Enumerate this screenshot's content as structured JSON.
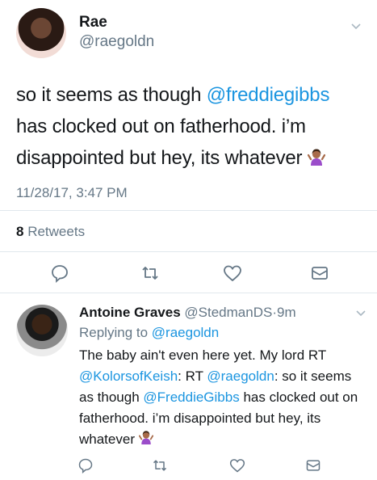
{
  "main": {
    "name": "Rae",
    "handle": "@raegoldn",
    "text_before": "so it seems as though ",
    "mention": "@freddiegibbs",
    "text_after": " has clocked out on fatherhood.  i’m disappointed but hey, its whatever",
    "emoji_icon": "woman-shrugging-emoji",
    "timestamp": "11/28/17, 3:47 PM",
    "retweet_count": "8",
    "retweet_label": "Retweets"
  },
  "reply": {
    "name": "Antoine Graves",
    "handle": "@StedmanDS",
    "separator": "·",
    "age": "9m",
    "replying_label": "Replying to",
    "replying_to": "@raegoldn",
    "t1": "The baby ain't even here yet.  My lord RT ",
    "m1": "@KolorsofKeish",
    "t2": ": RT ",
    "m2": "@raegoldn",
    "t3": ": so it seems as though ",
    "m3": "@FreddieGibbs",
    "t4": " has clocked out on fatherhood.  i’m disappointed but hey, its whatever"
  },
  "icons": {
    "reply": "reply-icon",
    "retweet": "retweet-icon",
    "like": "heart-icon",
    "dm": "envelope-icon",
    "more": "chevron-down-icon"
  },
  "colors": {
    "link": "#1b95e0",
    "muted": "#657786",
    "divider": "#e1e8ed"
  }
}
